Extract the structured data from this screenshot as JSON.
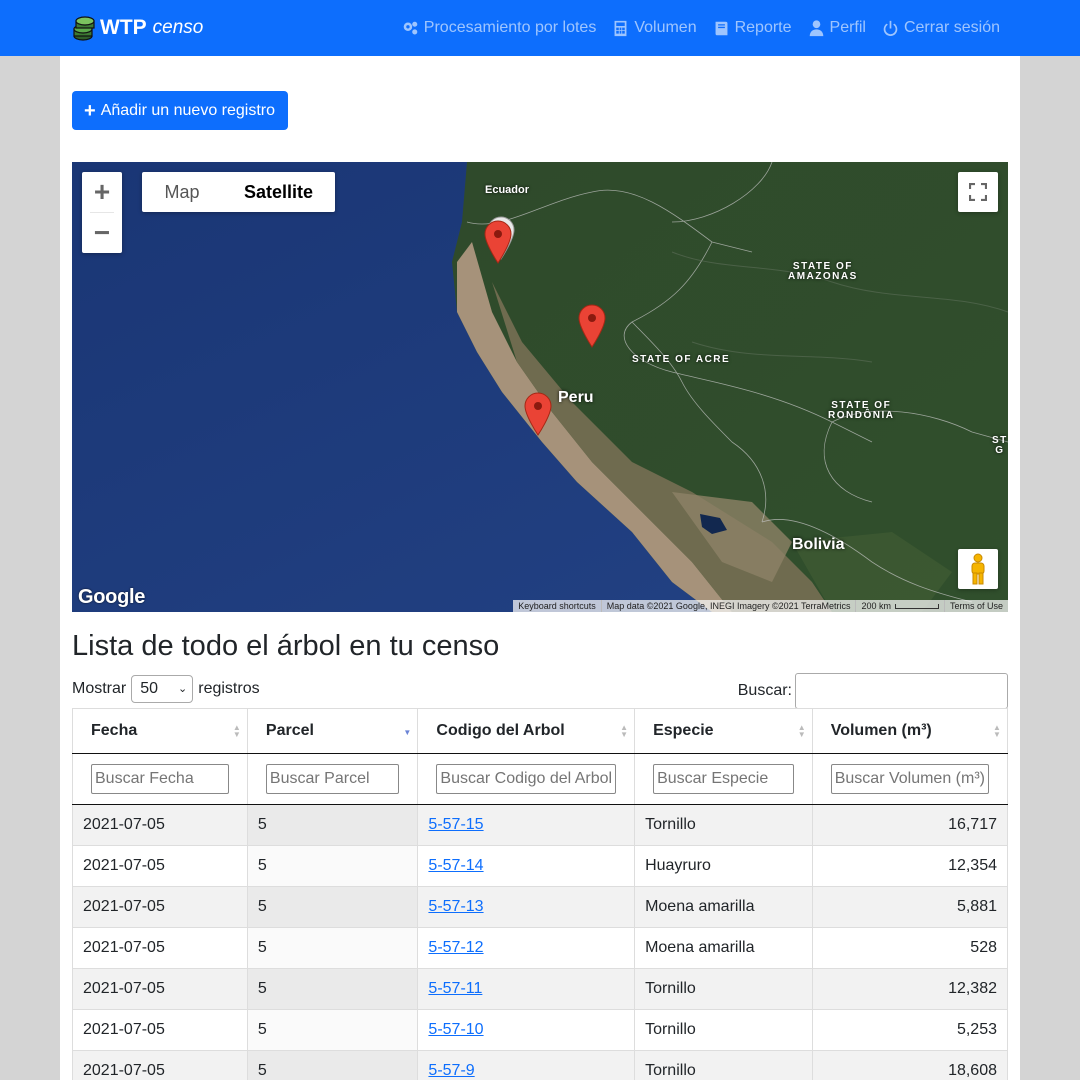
{
  "nav": {
    "brand_bold": "WTP",
    "brand_italic": "censo",
    "links": [
      {
        "label": "Procesamiento por lotes",
        "icon": "cogs-icon"
      },
      {
        "label": "Volumen",
        "icon": "calculator-icon"
      },
      {
        "label": "Reporte",
        "icon": "book-icon"
      },
      {
        "label": "Perfil",
        "icon": "user-icon"
      },
      {
        "label": "Cerrar sesión",
        "icon": "power-icon"
      }
    ]
  },
  "add_button": {
    "label": "Añadir un nuevo registro"
  },
  "map": {
    "type_options": [
      "Map",
      "Satellite"
    ],
    "selected_type": "Satellite",
    "labels": {
      "ecuador": "Ecuador",
      "peru": "Peru",
      "bolivia": "Bolivia",
      "amazonas": "STATE OF\nAMAZONAS",
      "acre": "STATE OF ACRE",
      "rondonia": "STATE OF\nRONDÔNIA",
      "edge": "ST\nG"
    },
    "logo": "Google",
    "attribution": {
      "shortcuts": "Keyboard shortcuts",
      "data": "Map data ©2021 Google, INEGI Imagery ©2021 TerraMetrics",
      "scale": "200 km",
      "terms": "Terms of Use"
    },
    "marker_count": 4
  },
  "list": {
    "title": "Lista de todo el árbol en tu censo",
    "show_prefix": "Mostrar",
    "show_value": "50",
    "show_suffix": "registros",
    "search_label": "Buscar:"
  },
  "table": {
    "columns": [
      "Fecha",
      "Parcel",
      "Codigo del Arbol",
      "Especie",
      "Volumen (m³)"
    ],
    "filters": [
      "Buscar Fecha",
      "Buscar Parcel",
      "Buscar Codigo del Arbol",
      "Buscar Especie",
      "Buscar Volumen (m³)"
    ],
    "sorted_column": "Parcel",
    "rows": [
      {
        "fecha": "2021-07-05",
        "parcel": "5",
        "codigo": "5-57-15",
        "especie": "Tornillo",
        "volumen": "16,717"
      },
      {
        "fecha": "2021-07-05",
        "parcel": "5",
        "codigo": "5-57-14",
        "especie": "Huayruro",
        "volumen": "12,354"
      },
      {
        "fecha": "2021-07-05",
        "parcel": "5",
        "codigo": "5-57-13",
        "especie": "Moena amarilla",
        "volumen": "5,881"
      },
      {
        "fecha": "2021-07-05",
        "parcel": "5",
        "codigo": "5-57-12",
        "especie": "Moena amarilla",
        "volumen": "528"
      },
      {
        "fecha": "2021-07-05",
        "parcel": "5",
        "codigo": "5-57-11",
        "especie": "Tornillo",
        "volumen": "12,382"
      },
      {
        "fecha": "2021-07-05",
        "parcel": "5",
        "codigo": "5-57-10",
        "especie": "Tornillo",
        "volumen": "5,253"
      },
      {
        "fecha": "2021-07-05",
        "parcel": "5",
        "codigo": "5-57-9",
        "especie": "Tornillo",
        "volumen": "18,608"
      }
    ]
  }
}
